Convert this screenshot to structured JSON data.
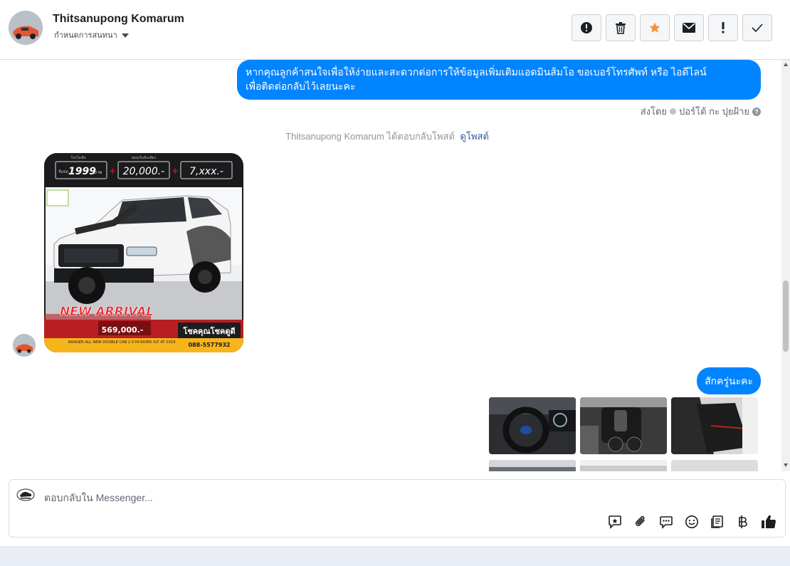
{
  "header": {
    "contact_name": "Thitsanupong Komarum",
    "subtitle": "กำหนดการสนทนา",
    "toolbar": [
      {
        "name": "alert-circle-icon"
      },
      {
        "name": "trash-icon"
      },
      {
        "name": "star-icon",
        "color": "#f7923b"
      },
      {
        "name": "mail-icon"
      },
      {
        "name": "exclamation-icon"
      },
      {
        "name": "check-icon"
      }
    ]
  },
  "conversation": {
    "message1": {
      "line1": "หากคุณลูกค้าสนใจเพื่อให้ง่ายและสะดวกต่อการให้ข้อมูลเพิ่มเติมแอดมินส้มโอ ขอเบอร์โทรศัพท์ หรือ ไอดีไลน์",
      "line2": "เพื่อติดต่อกลับไว้เลยนะคะ"
    },
    "sent_by": "ส่งโดย",
    "sent_by_name": "ปอร์โต้ กะ ปุยฝ้าย",
    "notice_text": "Thitsanupong Komarum ได้ตอบกลับโพสต์",
    "notice_link": "ดูโพสต์",
    "post_card": {
      "down_label": "โปรโมชั่น",
      "down_value": "1999",
      "down_prefix": "รับรถ",
      "down_unit": "บาท",
      "installment_label": "ผ่อนเริ่มต้นเพียง",
      "installment_value": "20,000.-",
      "monthly_value": "7,xxx.-",
      "badge": "NEW ARRIVAL",
      "price": "569,000.-",
      "phone": "088-5577932",
      "model": "RANGER ALL NEW DOUBLE CAB 2.0 HI-RIDER XLT AT 2019",
      "promo_text": "โชคคุณโชคดูดี"
    },
    "message2": "สักครู่นะคะ"
  },
  "composer": {
    "placeholder": "ตอบกลับใน Messenger...",
    "icons": [
      "sticker-icon",
      "attach-icon",
      "saved-reply-icon",
      "emoji-icon",
      "catalog-icon",
      "baht-icon",
      "like-icon"
    ]
  }
}
